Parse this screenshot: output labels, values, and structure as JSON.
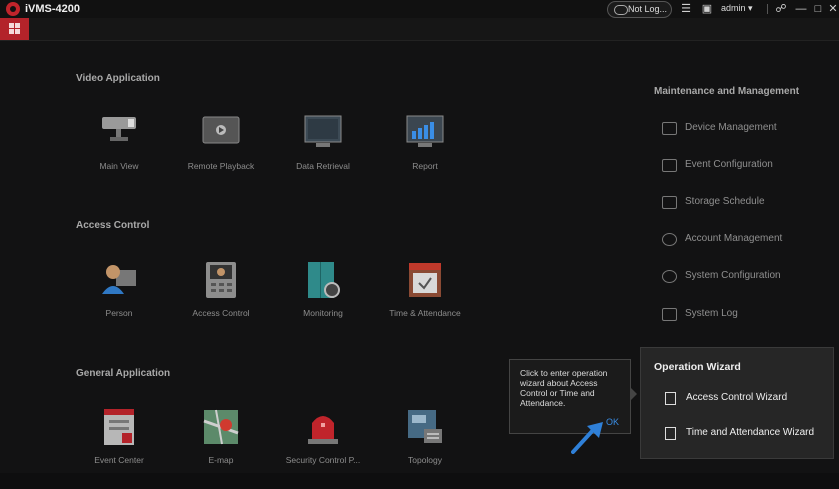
{
  "titlebar": {
    "app_title": "iVMS-4200",
    "login_status": "Not Log...",
    "user": "admin",
    "icons": [
      "menu-list-icon",
      "image-icon",
      "user-dropdown-icon",
      "lock-icon",
      "minimize-icon",
      "maximize-icon",
      "close-icon"
    ]
  },
  "sections": {
    "video": {
      "title": "Video Application",
      "tiles": [
        {
          "label": "Main View",
          "icon": "camera-icon"
        },
        {
          "label": "Remote Playback",
          "icon": "playback-icon"
        },
        {
          "label": "Data Retrieval",
          "icon": "monitor-icon"
        },
        {
          "label": "Report",
          "icon": "report-chart-icon"
        }
      ]
    },
    "access": {
      "title": "Access Control",
      "tiles": [
        {
          "label": "Person",
          "icon": "person-icon"
        },
        {
          "label": "Access Control",
          "icon": "door-station-icon"
        },
        {
          "label": "Monitoring",
          "icon": "door-monitor-icon"
        },
        {
          "label": "Time & Attendance",
          "icon": "calendar-icon"
        }
      ]
    },
    "general": {
      "title": "General Application",
      "tiles": [
        {
          "label": "Event Center",
          "icon": "event-center-icon"
        },
        {
          "label": "E-map",
          "icon": "map-pin-icon"
        },
        {
          "label": "Security Control P...",
          "icon": "alarm-siren-icon"
        },
        {
          "label": "Topology",
          "icon": "topology-icon"
        }
      ]
    }
  },
  "maintenance": {
    "title": "Maintenance and Management",
    "items": [
      {
        "label": "Device Management",
        "icon": "device-icon"
      },
      {
        "label": "Event Configuration",
        "icon": "event-config-icon"
      },
      {
        "label": "Storage Schedule",
        "icon": "storage-icon"
      },
      {
        "label": "Account Management",
        "icon": "account-icon"
      },
      {
        "label": "System Configuration",
        "icon": "gear-icon"
      },
      {
        "label": "System Log",
        "icon": "log-icon"
      }
    ]
  },
  "tooltip": {
    "text": "Click to enter operation wizard about Access Control or Time and Attendance.",
    "ok": "OK"
  },
  "wizard": {
    "title": "Operation Wizard",
    "items": [
      {
        "label": "Access Control Wizard"
      },
      {
        "label": "Time and Attendance Wizard"
      }
    ]
  },
  "colors": {
    "accent_red": "#b3232a",
    "link_blue": "#3a8ee6",
    "background": "#121213"
  }
}
